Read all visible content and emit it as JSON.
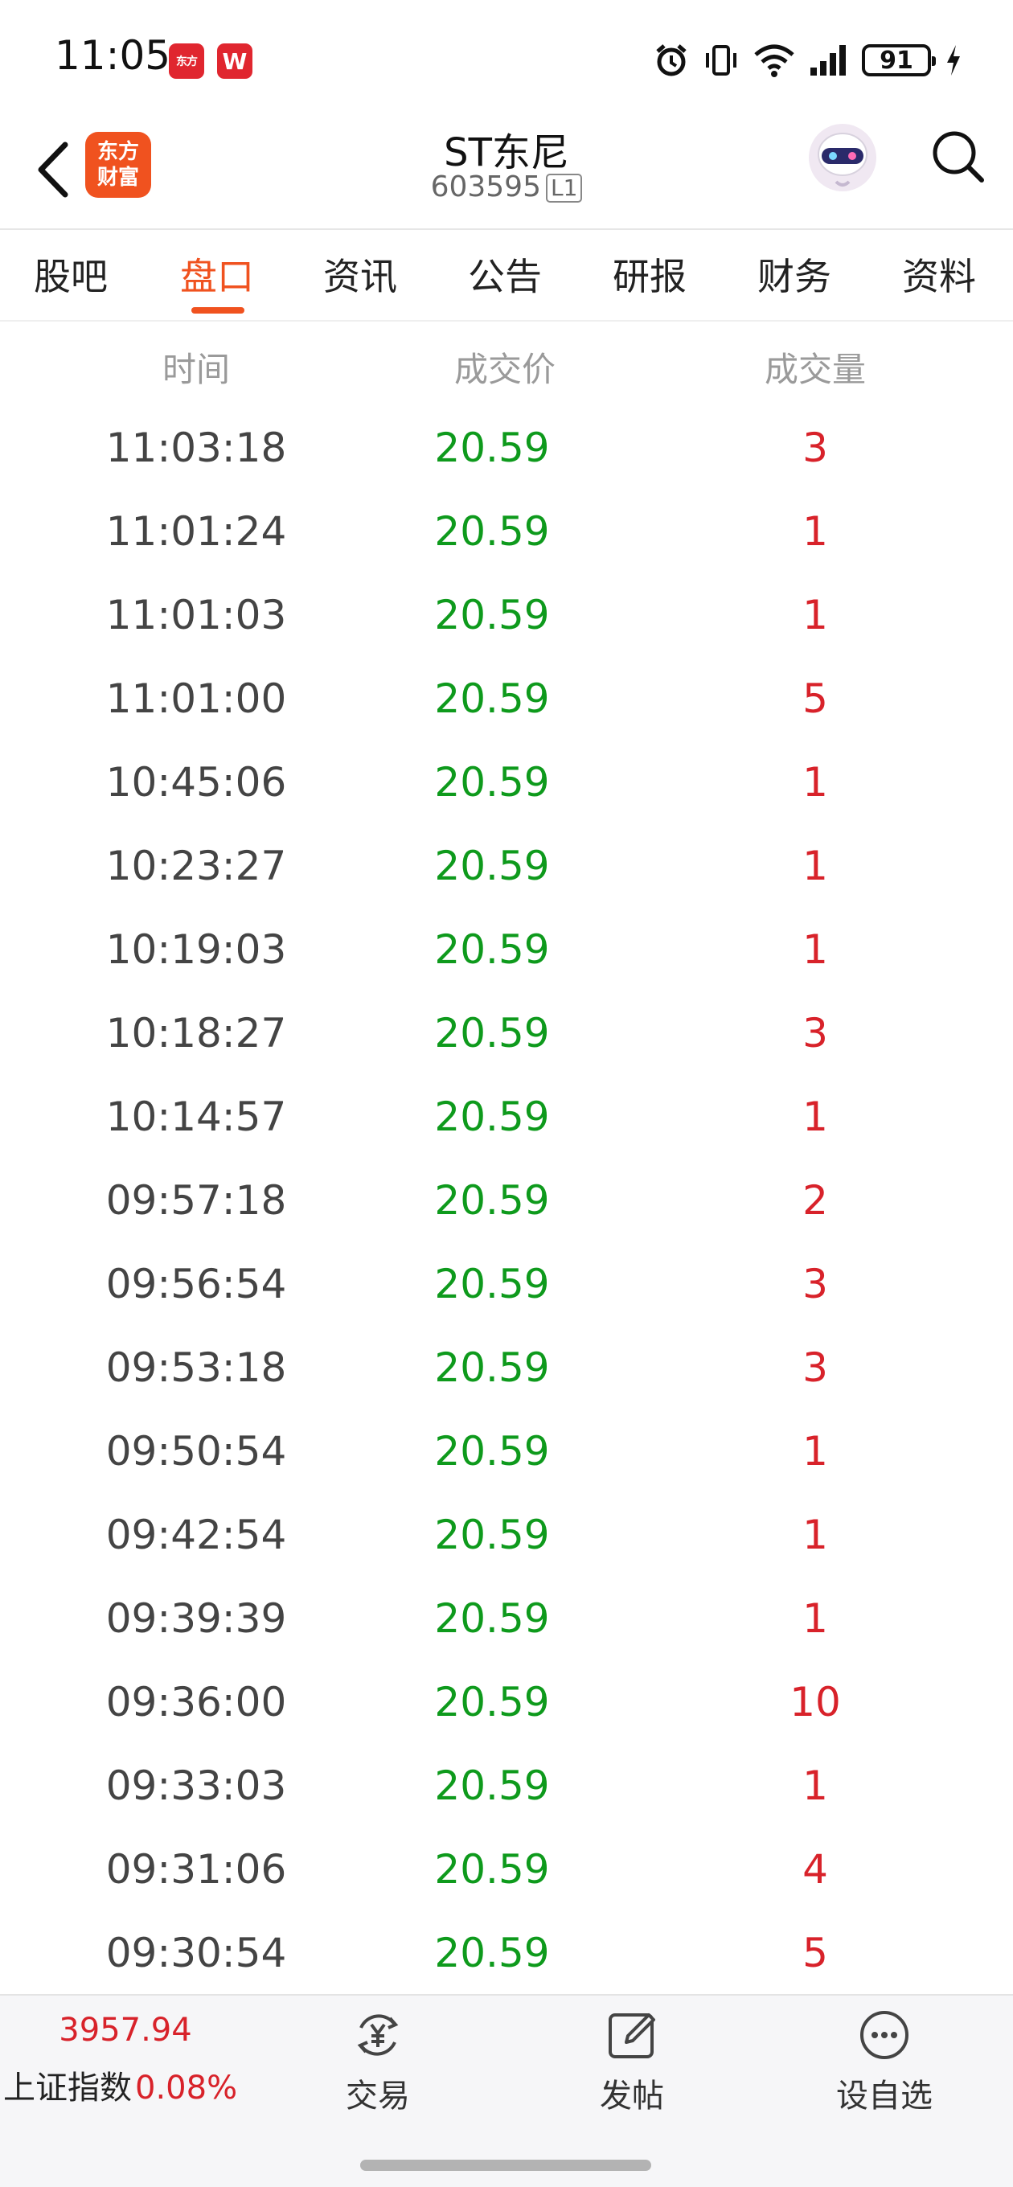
{
  "status_bar": {
    "time": "11:05",
    "app_icon_1": "东方",
    "app_icon_2": "W",
    "battery": "91"
  },
  "header": {
    "title": "ST东尼",
    "code": "603595",
    "level": "L1",
    "logo_line1": "东方",
    "logo_line2": "财富"
  },
  "tabs": [
    {
      "label": "股吧"
    },
    {
      "label": "盘口"
    },
    {
      "label": "资讯"
    },
    {
      "label": "公告"
    },
    {
      "label": "研报"
    },
    {
      "label": "财务"
    },
    {
      "label": "资料"
    }
  ],
  "active_tab": "盘口",
  "table": {
    "columns": [
      "时间",
      "成交价",
      "成交量"
    ],
    "rows": [
      {
        "time": "11:03:18",
        "price": "20.59",
        "volume": "3"
      },
      {
        "time": "11:01:24",
        "price": "20.59",
        "volume": "1"
      },
      {
        "time": "11:01:03",
        "price": "20.59",
        "volume": "1"
      },
      {
        "time": "11:01:00",
        "price": "20.59",
        "volume": "5"
      },
      {
        "time": "10:45:06",
        "price": "20.59",
        "volume": "1"
      },
      {
        "time": "10:23:27",
        "price": "20.59",
        "volume": "1"
      },
      {
        "time": "10:19:03",
        "price": "20.59",
        "volume": "1"
      },
      {
        "time": "10:18:27",
        "price": "20.59",
        "volume": "3"
      },
      {
        "time": "10:14:57",
        "price": "20.59",
        "volume": "1"
      },
      {
        "time": "09:57:18",
        "price": "20.59",
        "volume": "2"
      },
      {
        "time": "09:56:54",
        "price": "20.59",
        "volume": "3"
      },
      {
        "time": "09:53:18",
        "price": "20.59",
        "volume": "3"
      },
      {
        "time": "09:50:54",
        "price": "20.59",
        "volume": "1"
      },
      {
        "time": "09:42:54",
        "price": "20.59",
        "volume": "1"
      },
      {
        "time": "09:39:39",
        "price": "20.59",
        "volume": "1"
      },
      {
        "time": "09:36:00",
        "price": "20.59",
        "volume": "10"
      },
      {
        "time": "09:33:03",
        "price": "20.59",
        "volume": "1"
      },
      {
        "time": "09:31:06",
        "price": "20.59",
        "volume": "4"
      },
      {
        "time": "09:30:54",
        "price": "20.59",
        "volume": "5"
      }
    ]
  },
  "bottom_bar": {
    "index_value": "3957.94",
    "index_name": "上证指数",
    "index_change": "0.08%",
    "actions": [
      {
        "label": "交易",
        "icon": "trade-yuan-icon"
      },
      {
        "label": "发帖",
        "icon": "compose-icon"
      },
      {
        "label": "设自选",
        "icon": "more-dots-icon"
      }
    ]
  },
  "colors": {
    "accent": "#f0521f",
    "price_green": "#0e9a1c",
    "volume_red": "#d8222a",
    "muted": "#9a9a9a"
  }
}
